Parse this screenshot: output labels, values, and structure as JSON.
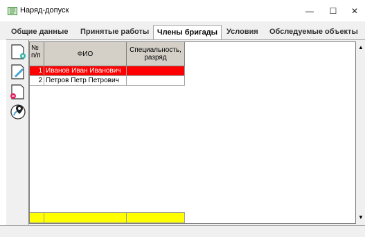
{
  "window": {
    "title": "Наряд-допуск",
    "minimize_glyph": "—",
    "maximize_glyph": "☐",
    "close_glyph": "✕",
    "icon": "document-icon"
  },
  "tabs": [
    {
      "label": "Общие данные",
      "active": false
    },
    {
      "label": "Принятые работы",
      "active": false
    },
    {
      "label": "Члены бригады",
      "active": true
    },
    {
      "label": "Условия",
      "active": false
    },
    {
      "label": "Обследуемые объекты",
      "active": false
    }
  ],
  "toolbar": {
    "buttons": [
      {
        "name": "add-document-icon"
      },
      {
        "name": "edit-document-icon"
      },
      {
        "name": "delete-document-icon"
      },
      {
        "name": "location-pin-icon"
      }
    ]
  },
  "grid": {
    "headers": {
      "num": "№ п/п",
      "fio": "ФИО",
      "spec": "Специальность, разряд"
    },
    "rows": [
      {
        "num": "1",
        "fio": "Иванов Иван Иванович",
        "spec": ""
      },
      {
        "num": "2",
        "fio": "Петров Петр Петрович",
        "spec": ""
      }
    ],
    "selected_row_color": "#ff0000",
    "footer_color": "#ffff00"
  },
  "scroll": {
    "up_glyph": "▲",
    "down_glyph": "▼"
  }
}
